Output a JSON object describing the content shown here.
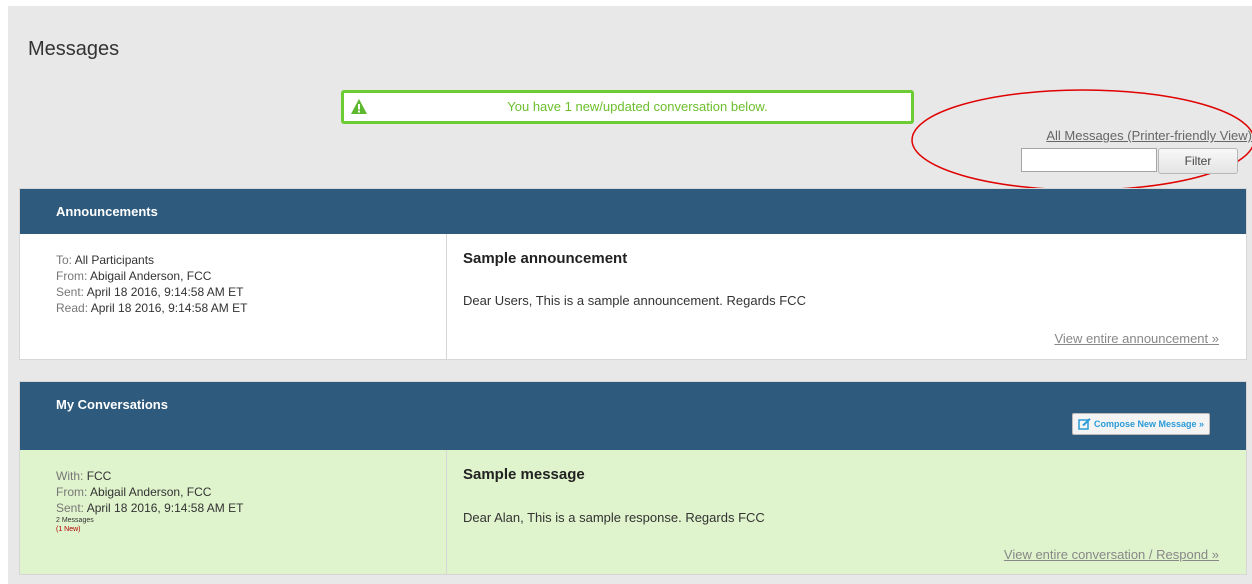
{
  "page": {
    "title": "Messages"
  },
  "alert": {
    "text": "You have 1 new/updated conversation below.",
    "icon": "warning-icon",
    "color": "#6ccc34"
  },
  "toolbar": {
    "printer_link": "All Messages (Printer-friendly View)",
    "filter_value": "",
    "filter_label": "Filter"
  },
  "announcements": {
    "title": "Announcements",
    "items": [
      {
        "to_label": "To:",
        "to": "All Participants",
        "from_label": "From:",
        "from": "Abigail Anderson, FCC",
        "sent_label": "Sent:",
        "sent": "April 18 2016,  9:14:58 AM ET",
        "read_label": "Read:",
        "read": "April 18 2016,  9:14:58 AM ET",
        "subject": "Sample announcement",
        "body": "Dear Users, This is a sample announcement. Regards FCC",
        "link": "View entire announcement »"
      }
    ]
  },
  "conversations": {
    "title": "My Conversations",
    "compose_label": "Compose New Message »",
    "items": [
      {
        "with_label": "With:",
        "with": "FCC",
        "from_label": "From:",
        "from": "Abigail Anderson, FCC",
        "sent_label": "Sent:",
        "sent": "April 18 2016,  9:14:58 AM ET",
        "count": "2 Messages",
        "new": "(1 New)",
        "subject": "Sample message",
        "body": "Dear Alan, This is a sample response. Regards FCC",
        "link": "View entire conversation / Respond »"
      }
    ]
  },
  "colors": {
    "header_bg": "#2d5a7d",
    "unread_row_bg": "#dff3cc",
    "alert_border": "#6ccc34",
    "annotation": "#e00000"
  }
}
